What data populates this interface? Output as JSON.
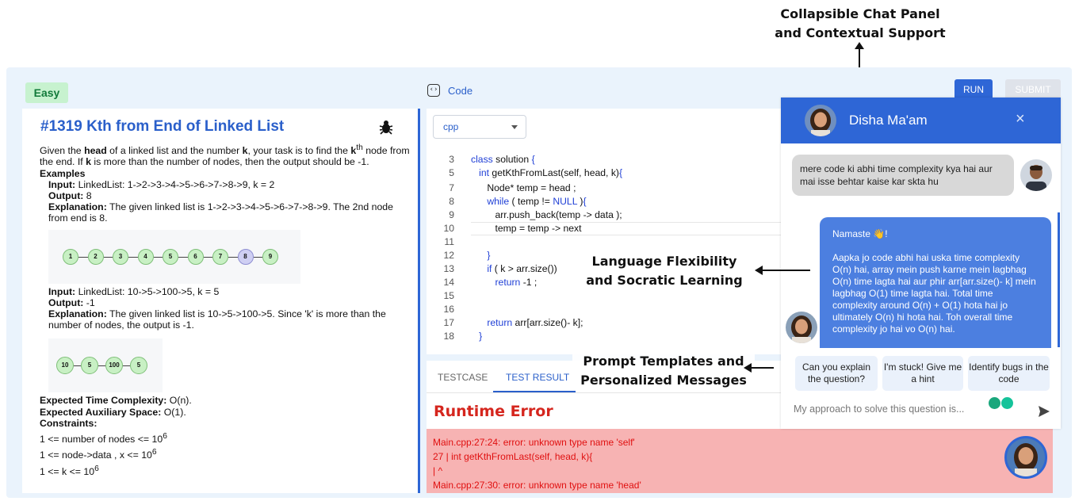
{
  "annotations": {
    "top": [
      "Collapsible Chat Panel",
      "and Contextual Support"
    ],
    "middle": [
      "Language Flexibility",
      "and Socratic Learning"
    ],
    "lower": [
      "Prompt Templates and",
      "Personalized Messages"
    ]
  },
  "problem": {
    "difficulty": "Easy",
    "title": "#1319 Kth from End of Linked List",
    "desc_1": "Given the ",
    "desc_head": "head",
    "desc_2": " of a linked list and the number ",
    "desc_k": "k",
    "desc_3": ", your task is to find the ",
    "desc_k2": "k",
    "desc_th": "th",
    "desc_4": " node from the end. If ",
    "desc_k3": "k",
    "desc_5": " is more than the number of nodes, then the output should be -1.",
    "examples_label": "Examples",
    "input_label": "Input:",
    "output_label": "Output:",
    "explanation_label": "Explanation:",
    "ex1_input": " LinkedList: 1->2->3->4->5->6->7->8->9, k = 2",
    "ex1_output": " 8",
    "ex1_expl": " The given linked list is 1->2->3->4->5->6->7->8->9. The 2nd node from end is 8.",
    "ex1_nodes": [
      "1",
      "2",
      "3",
      "4",
      "5",
      "6",
      "7",
      "8",
      "9"
    ],
    "ex2_input": " LinkedList: 10->5->100->5, k = 5",
    "ex2_output": " -1",
    "ex2_expl": " The given linked list is 10->5->100->5. Since 'k' is more than the number of nodes, the output is -1.",
    "ex2_nodes": [
      "10",
      "5",
      "100",
      "5"
    ],
    "time_label": "Expected Time Complexity:",
    "time_value": " O(n).",
    "space_label": "Expected Auxiliary Space:",
    "space_value": " O(1).",
    "constraints_label": "Constraints:",
    "c1": "1 <= number of nodes <= 10",
    "c1_sup": "6",
    "c2": "1 <= node->data , x <= 10",
    "c2_sup": "6",
    "c3": "1 <= k <= 10",
    "c3_sup": "6"
  },
  "editor": {
    "header_label": "Code",
    "run_label": "RUN",
    "submit_label": "SUBMIT",
    "language": "cpp",
    "lines": [
      {
        "n": "3",
        "code": "class solution {"
      },
      {
        "n": "5",
        "code": "   int getKthFromLast(self, head, k){"
      },
      {
        "n": "7",
        "code": "      Node* temp = head ;"
      },
      {
        "n": "8",
        "code": "      while ( temp != NULL ){"
      },
      {
        "n": "9",
        "code": "         arr.push_back(temp -> data );"
      },
      {
        "n": "10",
        "code": "         temp = temp -> next"
      },
      {
        "n": "11",
        "code": ""
      },
      {
        "n": "12",
        "code": "      }"
      },
      {
        "n": "13",
        "code": "      if ( k > arr.size())"
      },
      {
        "n": "14",
        "code": "         return -1 ;"
      },
      {
        "n": "15",
        "code": ""
      },
      {
        "n": "16",
        "code": ""
      },
      {
        "n": "17",
        "code": "      return arr[arr.size()- k];"
      },
      {
        "n": "18",
        "code": "   }"
      }
    ]
  },
  "results": {
    "tab_testcase": "TESTCASE",
    "tab_result": "TEST RESULT",
    "error_title": "Runtime Error",
    "errors": [
      "Main.cpp:27:24: error: unknown type name 'self'",
      "27 | int getKthFromLast(self, head, k){",
      "| ^",
      "Main.cpp:27:30: error: unknown type name 'head'"
    ]
  },
  "chat": {
    "name": "Disha Ma'am",
    "close": "×",
    "user_message": "mere code ki abhi time complexity kya hai aur mai isse behtar kaise kar skta hu",
    "bot_greeting": "Namaste 👋!",
    "bot_message": "Aapka jo code abhi hai uska time complexity O(n) hai, array mein push karne mein lagbhag O(n) time lagta hai aur phir arr[arr.size()- k] mein lagbhag O(1) time lagta hai. Total time complexity around O(n) + O(1) hota hai jo ultimately O(n) hi hota hai. Toh overall time complexity jo hai vo O(n) hai.",
    "suggestions": [
      "Can you explain the question?",
      "I'm stuck! Give me a hint",
      "Identify bugs in the code"
    ],
    "input_placeholder": "My approach to solve this question is..."
  },
  "colors": {
    "accent": "#2e66d6",
    "error": "#d5261e",
    "easy_bg": "#c7f2cf"
  }
}
